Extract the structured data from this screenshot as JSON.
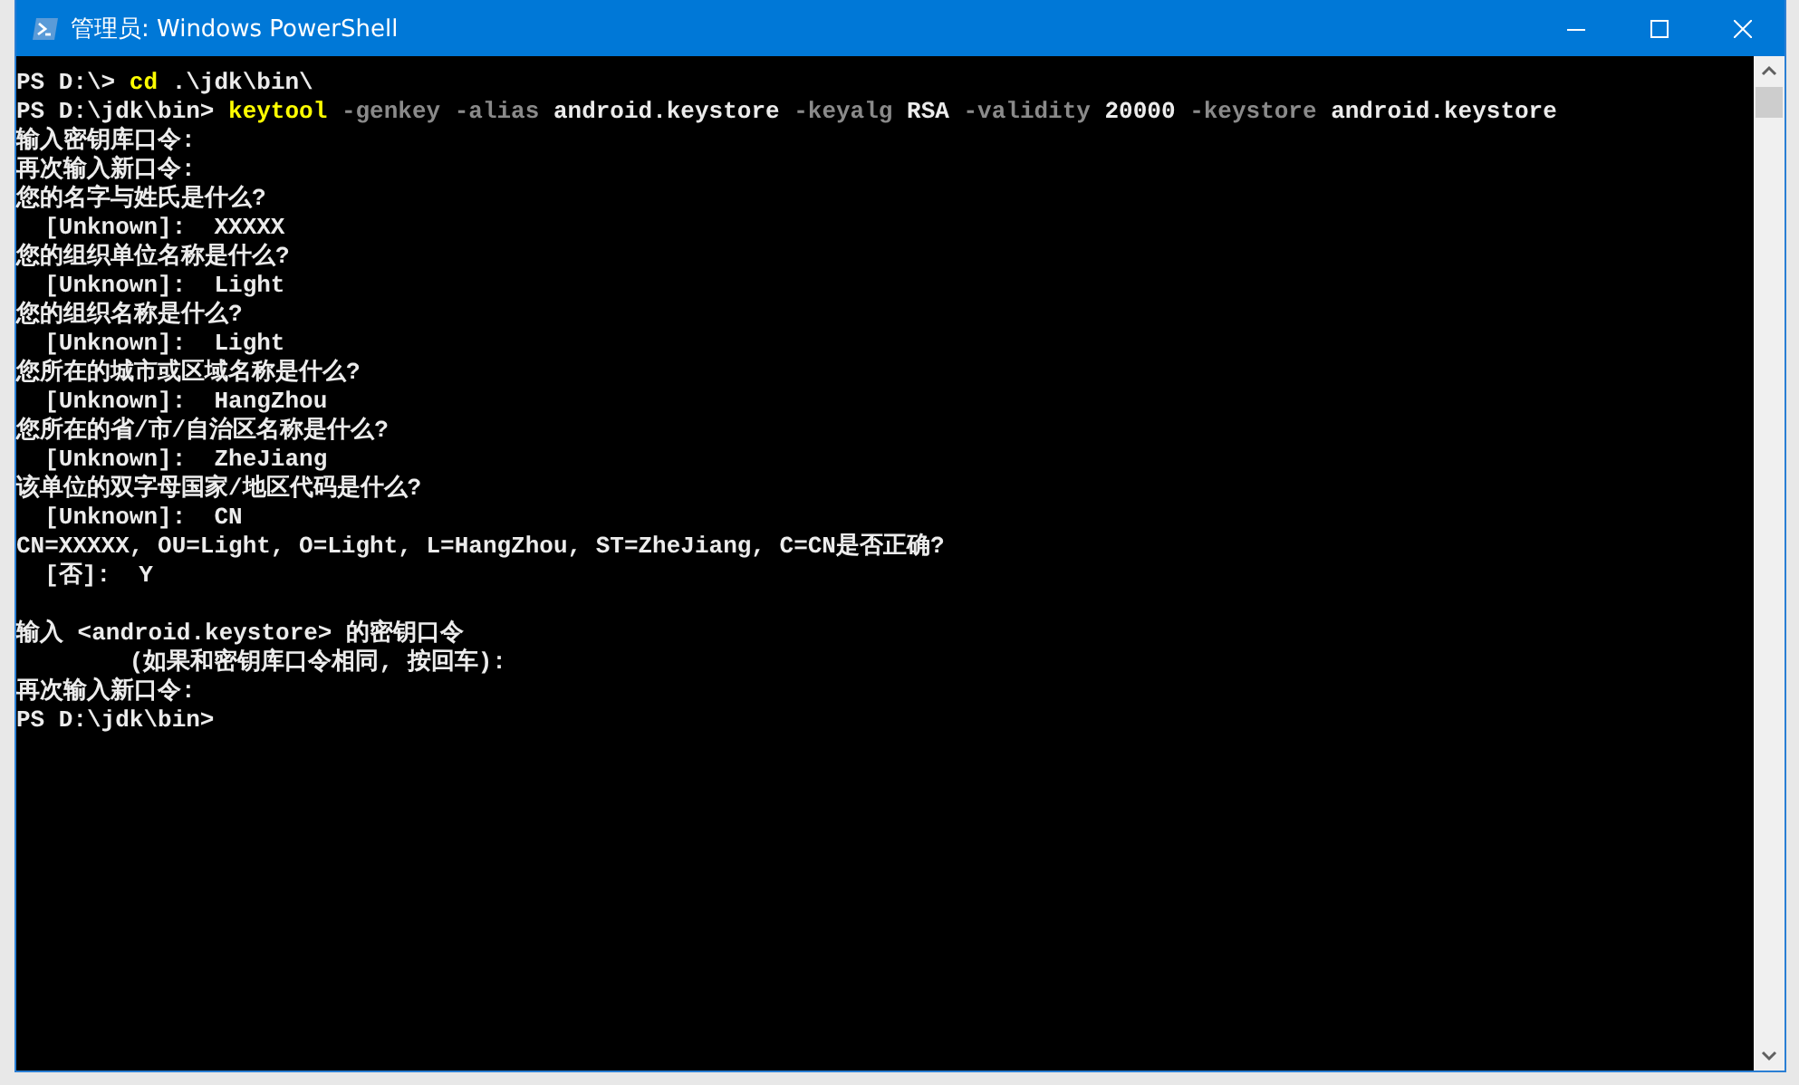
{
  "window": {
    "title": "管理员: Windows PowerShell"
  },
  "lines": [
    {
      "kind": "text",
      "segments": [
        {
          "kind": "plain",
          "text": "PS D:\\> "
        },
        {
          "kind": "command",
          "text": "cd"
        },
        {
          "kind": "plain",
          "text": " .\\jdk\\bin\\"
        }
      ]
    },
    {
      "kind": "text",
      "segments": [
        {
          "kind": "plain",
          "text": "PS D:\\jdk\\bin> "
        },
        {
          "kind": "command",
          "text": "keytool"
        },
        {
          "kind": "param",
          "text": " -genkey -alias"
        },
        {
          "kind": "plain",
          "text": " android.keystore"
        },
        {
          "kind": "param",
          "text": " -keyalg"
        },
        {
          "kind": "plain",
          "text": " RSA"
        },
        {
          "kind": "param",
          "text": " -validity"
        },
        {
          "kind": "plain",
          "text": " 20000"
        },
        {
          "kind": "param",
          "text": " -keystore"
        },
        {
          "kind": "plain",
          "text": " android.keystore"
        }
      ]
    },
    {
      "kind": "text",
      "segments": [
        {
          "kind": "plain",
          "text": "输入密钥库口令:"
        }
      ]
    },
    {
      "kind": "text",
      "segments": [
        {
          "kind": "plain",
          "text": "再次输入新口令:"
        }
      ]
    },
    {
      "kind": "text",
      "segments": [
        {
          "kind": "plain",
          "text": "您的名字与姓氏是什么?"
        }
      ]
    },
    {
      "kind": "text",
      "segments": [
        {
          "kind": "plain",
          "text": "  [Unknown]:  XXXXX"
        }
      ]
    },
    {
      "kind": "text",
      "segments": [
        {
          "kind": "plain",
          "text": "您的组织单位名称是什么?"
        }
      ]
    },
    {
      "kind": "text",
      "segments": [
        {
          "kind": "plain",
          "text": "  [Unknown]:  Light"
        }
      ]
    },
    {
      "kind": "text",
      "segments": [
        {
          "kind": "plain",
          "text": "您的组织名称是什么?"
        }
      ]
    },
    {
      "kind": "text",
      "segments": [
        {
          "kind": "plain",
          "text": "  [Unknown]:  Light"
        }
      ]
    },
    {
      "kind": "text",
      "segments": [
        {
          "kind": "plain",
          "text": "您所在的城市或区域名称是什么?"
        }
      ]
    },
    {
      "kind": "text",
      "segments": [
        {
          "kind": "plain",
          "text": "  [Unknown]:  HangZhou"
        }
      ]
    },
    {
      "kind": "text",
      "segments": [
        {
          "kind": "plain",
          "text": "您所在的省/市/自治区名称是什么?"
        }
      ]
    },
    {
      "kind": "text",
      "segments": [
        {
          "kind": "plain",
          "text": "  [Unknown]:  ZheJiang"
        }
      ]
    },
    {
      "kind": "text",
      "segments": [
        {
          "kind": "plain",
          "text": "该单位的双字母国家/地区代码是什么?"
        }
      ]
    },
    {
      "kind": "text",
      "segments": [
        {
          "kind": "plain",
          "text": "  [Unknown]:  CN"
        }
      ]
    },
    {
      "kind": "text",
      "segments": [
        {
          "kind": "plain",
          "text": "CN=XXXXX, OU=Light, O=Light, L=HangZhou, ST=ZheJiang, C=CN是否正确?"
        }
      ]
    },
    {
      "kind": "text",
      "segments": [
        {
          "kind": "plain",
          "text": "  [否]:  Y"
        }
      ]
    },
    {
      "kind": "blank"
    },
    {
      "kind": "text",
      "segments": [
        {
          "kind": "plain",
          "text": "输入 <android.keystore> 的密钥口令"
        }
      ]
    },
    {
      "kind": "text",
      "segments": [
        {
          "kind": "plain",
          "text": "        (如果和密钥库口令相同, 按回车):"
        }
      ]
    },
    {
      "kind": "text",
      "segments": [
        {
          "kind": "plain",
          "text": "再次输入新口令:"
        }
      ]
    },
    {
      "kind": "text",
      "segments": [
        {
          "kind": "plain",
          "text": "PS D:\\jdk\\bin>"
        }
      ]
    }
  ]
}
